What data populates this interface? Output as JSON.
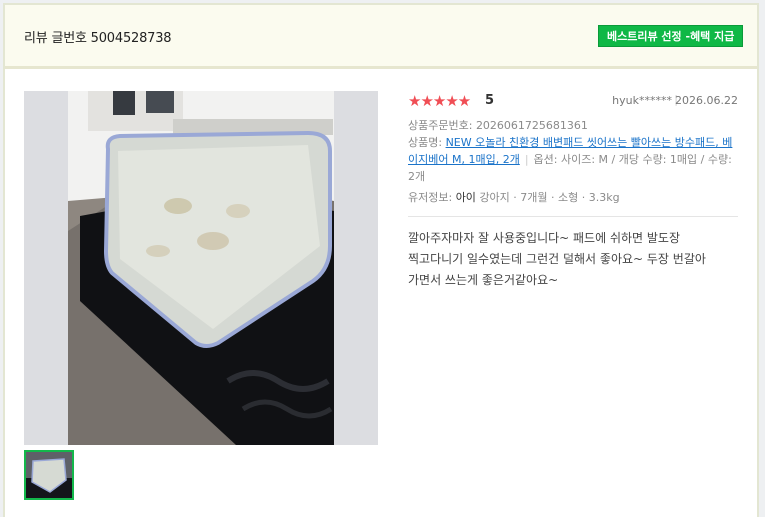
{
  "header": {
    "review_id": "리뷰 글번호 5004528738",
    "best_badge": "베스트리뷰 선정 -혜택 지급"
  },
  "review": {
    "stars": "★★★★★",
    "score": "5",
    "rating": 5,
    "author": "hyuk******",
    "date": "2026.06.22",
    "order_label": "상품주문번호:",
    "order_number": "2026061725681361",
    "product_label": "상품명:",
    "product_name": "NEW 오놀라 친환경 배변패드 씻어쓰는 빨아쓰는 방수패드, 베이지베어 M, 1매입, 2개",
    "option_text": "옵션: 사이즈: M / 개당 수량: 1매입 / 수량: 2개",
    "pet_label": "유저정보:",
    "pet_name": "아이",
    "pet_details": "강아지 · 7개월 · 소형 · 3.3kg",
    "content": "깔아주자마자 잘 사용중입니다~ 패드에 쉬하면 발도장 찍고다니기 일수였는데 그런건 덜해서 좋아요~ 두장 번갈아 가면서 쓰는게 좋은거같아요~"
  },
  "colors": {
    "badge_green": "#0fb846",
    "star_red": "#f04e55",
    "link_blue": "#1a73c9"
  }
}
